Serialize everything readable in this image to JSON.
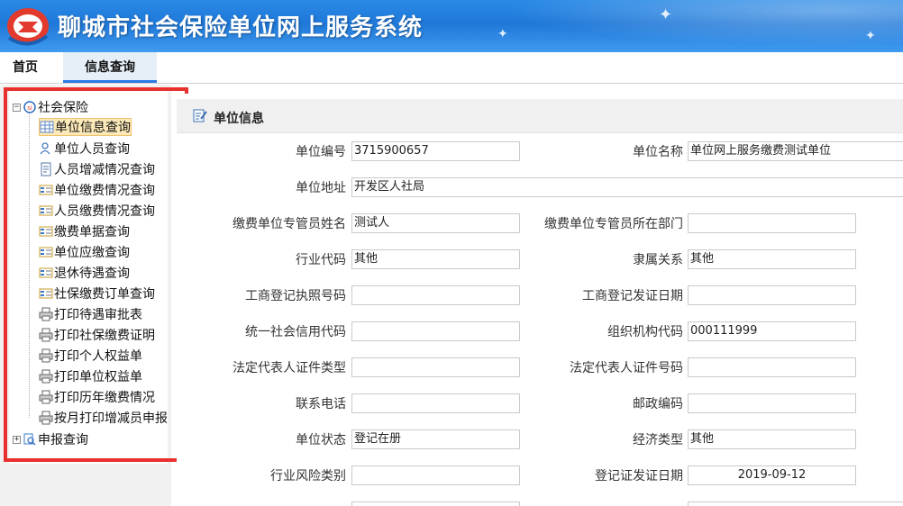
{
  "app": {
    "title": "聊城市社会保险单位网上服务系统"
  },
  "tabs": [
    {
      "label": "首页"
    },
    {
      "label": "信息查询"
    }
  ],
  "sidebar": {
    "root": {
      "label": "社会保险"
    },
    "items": [
      {
        "label": "单位信息查询",
        "icon": "grid-icon"
      },
      {
        "label": "单位人员查询",
        "icon": "user-icon"
      },
      {
        "label": "人员增减情况查询",
        "icon": "document-icon"
      },
      {
        "label": "单位缴费情况查询",
        "icon": "list-card-icon"
      },
      {
        "label": "人员缴费情况查询",
        "icon": "list-card-icon"
      },
      {
        "label": "缴费单据查询",
        "icon": "list-card-icon"
      },
      {
        "label": "单位应缴查询",
        "icon": "list-card-icon"
      },
      {
        "label": "退休待遇查询",
        "icon": "list-card-icon"
      },
      {
        "label": "社保缴费订单查询",
        "icon": "list-card-icon"
      },
      {
        "label": "打印待遇审批表",
        "icon": "printer-icon"
      },
      {
        "label": "打印社保缴费证明",
        "icon": "printer-icon"
      },
      {
        "label": "打印个人权益单",
        "icon": "printer-icon"
      },
      {
        "label": "打印单位权益单",
        "icon": "printer-icon"
      },
      {
        "label": "打印历年缴费情况",
        "icon": "printer-icon"
      },
      {
        "label": "按月打印增减员申报",
        "icon": "printer-icon"
      }
    ],
    "second_root": {
      "label": "申报查询"
    }
  },
  "main": {
    "section_title": "单位信息",
    "fields": {
      "unit_no": {
        "label": "单位编号",
        "value": "3715900657"
      },
      "unit_name": {
        "label": "单位名称",
        "value": "单位网上服务缴费测试单位"
      },
      "unit_address": {
        "label": "单位地址",
        "value": "开发区人社局"
      },
      "manager_name": {
        "label": "缴费单位专管员姓名",
        "value": "测试人"
      },
      "manager_dept": {
        "label": "缴费单位专管员所在部门",
        "value": ""
      },
      "industry_code": {
        "label": "行业代码",
        "value": "其他"
      },
      "affiliation": {
        "label": "隶属关系",
        "value": "其他"
      },
      "license_no": {
        "label": "工商登记执照号码",
        "value": ""
      },
      "license_date": {
        "label": "工商登记发证日期",
        "value": ""
      },
      "credit_code": {
        "label": "统一社会信用代码",
        "value": ""
      },
      "org_code": {
        "label": "组织机构代码",
        "value": "000111999"
      },
      "rep_id_type": {
        "label": "法定代表人证件类型",
        "value": ""
      },
      "rep_id_no": {
        "label": "法定代表人证件号码",
        "value": ""
      },
      "phone": {
        "label": "联系电话",
        "value": ""
      },
      "postcode": {
        "label": "邮政编码",
        "value": ""
      },
      "unit_status": {
        "label": "单位状态",
        "value": "登记在册"
      },
      "economy_type": {
        "label": "经济类型",
        "value": "其他"
      },
      "risk_category": {
        "label": "行业风险类别",
        "value": ""
      },
      "reg_cert_date": {
        "label": "登记证发证日期",
        "value": "2019-09-12"
      }
    }
  },
  "colors": {
    "header": "#1f78d8",
    "highlight_border": "#e8312f",
    "selected_bg": "#fdeab8",
    "active_tab": "#2c7be5"
  }
}
